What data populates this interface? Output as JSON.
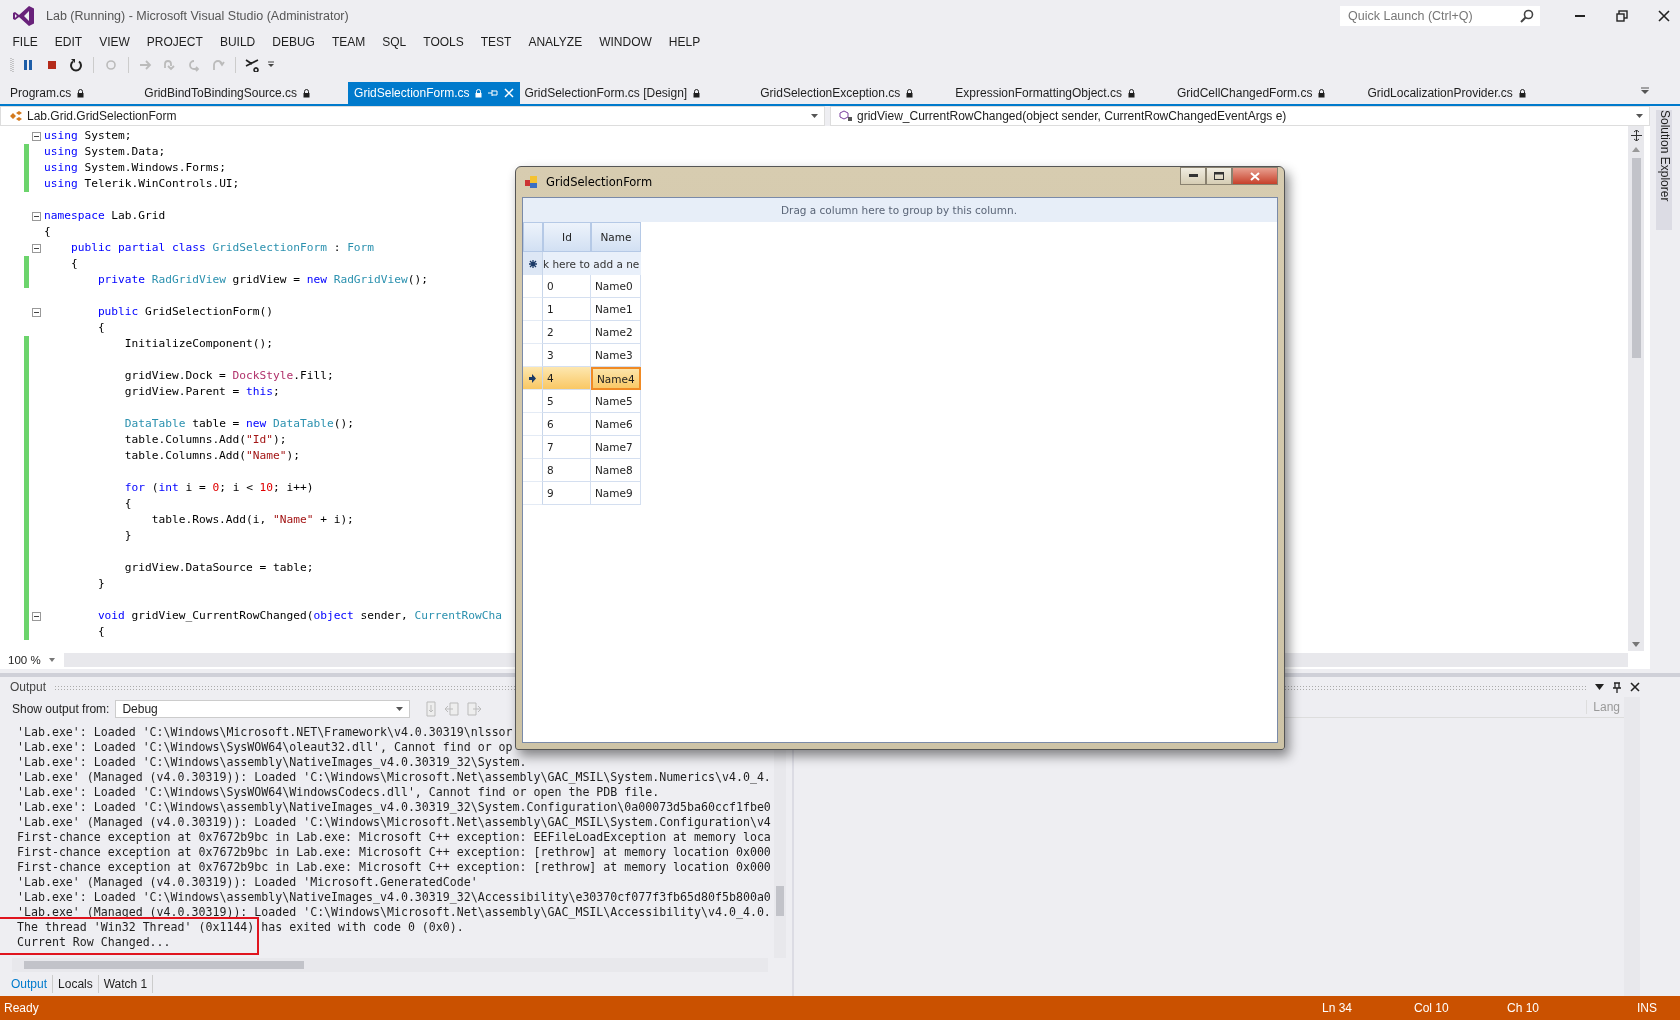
{
  "window": {
    "title": "Lab (Running) - Microsoft Visual Studio (Administrator)",
    "quick_launch": {
      "placeholder": "Quick Launch (Ctrl+Q)"
    }
  },
  "menu": [
    "FILE",
    "EDIT",
    "VIEW",
    "PROJECT",
    "BUILD",
    "DEBUG",
    "TEAM",
    "SQL",
    "TOOLS",
    "TEST",
    "ANALYZE",
    "WINDOW",
    "HELP"
  ],
  "tabs": [
    {
      "label": "Program.cs",
      "selected": false
    },
    {
      "label": "GridBindToBindingSource.cs",
      "selected": false
    },
    {
      "label": "GridSelectionForm.cs",
      "selected": true
    },
    {
      "label": "GridSelectionForm.cs [Design]",
      "selected": false
    },
    {
      "label": "GridSelectionException.cs",
      "selected": false
    },
    {
      "label": "ExpressionFormattingObject.cs",
      "selected": false
    },
    {
      "label": "GridCellChangedForm.cs",
      "selected": false
    },
    {
      "label": "GridLocalizationProvider.cs",
      "selected": false
    }
  ],
  "navigation": {
    "type_box": "Lab.Grid.GridSelectionForm",
    "member_box": "gridView_CurrentRowChanged(object sender, CurrentRowChangedEventArgs e)"
  },
  "code_lines": [
    {
      "kind": "code",
      "changed": false,
      "fold": true,
      "tokens": [
        {
          "kind": "keyword",
          "t": "using"
        },
        {
          "kind": "plain",
          "t": " System;"
        }
      ]
    },
    {
      "kind": "code",
      "changed": true,
      "fold": false,
      "tokens": [
        {
          "kind": "keyword",
          "t": "using"
        },
        {
          "kind": "plain",
          "t": " System.Data;"
        }
      ]
    },
    {
      "kind": "code",
      "changed": true,
      "fold": false,
      "tokens": [
        {
          "kind": "keyword",
          "t": "using"
        },
        {
          "kind": "plain",
          "t": " System.Windows.Forms;"
        }
      ]
    },
    {
      "kind": "code",
      "changed": true,
      "fold": false,
      "tokens": [
        {
          "kind": "keyword",
          "t": "using"
        },
        {
          "kind": "plain",
          "t": " Telerik.WinControls.UI;"
        }
      ]
    },
    {
      "kind": "blank",
      "changed": false,
      "fold": false
    },
    {
      "kind": "code",
      "changed": false,
      "fold": true,
      "tokens": [
        {
          "kind": "keyword",
          "t": "namespace"
        },
        {
          "kind": "plain",
          "t": " Lab.Grid"
        }
      ]
    },
    {
      "kind": "code",
      "changed": false,
      "fold": false,
      "tokens": [
        {
          "kind": "plain",
          "t": "{"
        }
      ]
    },
    {
      "kind": "code",
      "changed": false,
      "fold": true,
      "tokens": [
        {
          "kind": "keyword",
          "t": "    public partial class"
        },
        {
          "kind": "type",
          "t": " GridSelectionForm"
        },
        {
          "kind": "plain",
          "t": " : "
        },
        {
          "kind": "type",
          "t": "Form"
        }
      ]
    },
    {
      "kind": "code",
      "changed": true,
      "fold": false,
      "tokens": [
        {
          "kind": "plain",
          "t": "    {"
        }
      ]
    },
    {
      "kind": "code",
      "changed": true,
      "fold": false,
      "tokens": [
        {
          "kind": "keyword",
          "t": "        private"
        },
        {
          "kind": "type",
          "t": " RadGridView"
        },
        {
          "kind": "plain",
          "t": " gridView = "
        },
        {
          "kind": "keyword",
          "t": "new"
        },
        {
          "kind": "type",
          "t": " RadGridView"
        },
        {
          "kind": "plain",
          "t": "();"
        }
      ]
    },
    {
      "kind": "blank",
      "changed": false,
      "fold": false
    },
    {
      "kind": "code",
      "changed": false,
      "fold": true,
      "tokens": [
        {
          "kind": "keyword",
          "t": "        public"
        },
        {
          "kind": "plain",
          "t": " GridSelectionForm()"
        }
      ]
    },
    {
      "kind": "code",
      "changed": false,
      "fold": false,
      "tokens": [
        {
          "kind": "plain",
          "t": "        {"
        }
      ]
    },
    {
      "kind": "code",
      "changed": true,
      "fold": false,
      "tokens": [
        {
          "kind": "plain",
          "t": "            InitializeComponent();"
        }
      ]
    },
    {
      "kind": "blank",
      "changed": true,
      "fold": false
    },
    {
      "kind": "code",
      "changed": true,
      "fold": false,
      "tokens": [
        {
          "kind": "plain",
          "t": "            gridView.Dock = "
        },
        {
          "kind": "enum",
          "t": "DockStyle"
        },
        {
          "kind": "plain",
          "t": ".Fill;"
        }
      ]
    },
    {
      "kind": "code",
      "changed": true,
      "fold": false,
      "tokens": [
        {
          "kind": "plain",
          "t": "            gridView.Parent = "
        },
        {
          "kind": "keyword",
          "t": "this"
        },
        {
          "kind": "plain",
          "t": ";"
        }
      ]
    },
    {
      "kind": "blank",
      "changed": true,
      "fold": false
    },
    {
      "kind": "code",
      "changed": true,
      "fold": false,
      "tokens": [
        {
          "kind": "type",
          "t": "            DataTable"
        },
        {
          "kind": "plain",
          "t": " table = "
        },
        {
          "kind": "keyword",
          "t": "new"
        },
        {
          "kind": "type",
          "t": " DataTable"
        },
        {
          "kind": "plain",
          "t": "();"
        }
      ]
    },
    {
      "kind": "code",
      "changed": true,
      "fold": false,
      "tokens": [
        {
          "kind": "plain",
          "t": "            table.Columns.Add("
        },
        {
          "kind": "string",
          "t": "\"Id\""
        },
        {
          "kind": "plain",
          "t": ");"
        }
      ]
    },
    {
      "kind": "code",
      "changed": true,
      "fold": false,
      "tokens": [
        {
          "kind": "plain",
          "t": "            table.Columns.Add("
        },
        {
          "kind": "string",
          "t": "\"Name\""
        },
        {
          "kind": "plain",
          "t": ");"
        }
      ]
    },
    {
      "kind": "blank",
      "changed": true,
      "fold": false
    },
    {
      "kind": "code",
      "changed": true,
      "fold": false,
      "tokens": [
        {
          "kind": "keyword",
          "t": "            for"
        },
        {
          "kind": "plain",
          "t": " ("
        },
        {
          "kind": "keyword",
          "t": "int"
        },
        {
          "kind": "plain",
          "t": " i = "
        },
        {
          "kind": "number",
          "t": "0"
        },
        {
          "kind": "plain",
          "t": "; i < "
        },
        {
          "kind": "number",
          "t": "10"
        },
        {
          "kind": "plain",
          "t": "; i++)"
        }
      ]
    },
    {
      "kind": "code",
      "changed": true,
      "fold": false,
      "tokens": [
        {
          "kind": "plain",
          "t": "            {"
        }
      ]
    },
    {
      "kind": "code",
      "changed": true,
      "fold": false,
      "tokens": [
        {
          "kind": "plain",
          "t": "                table.Rows.Add(i, "
        },
        {
          "kind": "string",
          "t": "\"Name\""
        },
        {
          "kind": "plain",
          "t": " + i);"
        }
      ]
    },
    {
      "kind": "code",
      "changed": true,
      "fold": false,
      "tokens": [
        {
          "kind": "plain",
          "t": "            }"
        }
      ]
    },
    {
      "kind": "blank",
      "changed": true,
      "fold": false
    },
    {
      "kind": "code",
      "changed": true,
      "fold": false,
      "tokens": [
        {
          "kind": "plain",
          "t": "            gridView.DataSource = table;"
        }
      ]
    },
    {
      "kind": "code",
      "changed": true,
      "fold": false,
      "tokens": [
        {
          "kind": "plain",
          "t": "        }"
        }
      ]
    },
    {
      "kind": "blank",
      "changed": true,
      "fold": false
    },
    {
      "kind": "code",
      "changed": true,
      "fold": true,
      "tokens": [
        {
          "kind": "keyword",
          "t": "        void"
        },
        {
          "kind": "plain",
          "t": " gridView_CurrentRowChanged("
        },
        {
          "kind": "keyword",
          "t": "object"
        },
        {
          "kind": "plain",
          "t": " sender, "
        },
        {
          "kind": "type",
          "t": "CurrentRowCha"
        }
      ]
    },
    {
      "kind": "code",
      "changed": true,
      "fold": false,
      "tokens": [
        {
          "kind": "plain",
          "t": "        {"
        }
      ]
    }
  ],
  "zoom": "100 %",
  "form": {
    "title": "GridSelectionForm",
    "group_panel": "Drag a column here to group by this column.",
    "columns": [
      "Id",
      "Name"
    ],
    "new_row": "k here to add a ne",
    "rows": [
      {
        "id": "0",
        "name": "Name0",
        "selected": false
      },
      {
        "id": "1",
        "name": "Name1",
        "selected": false
      },
      {
        "id": "2",
        "name": "Name2",
        "selected": false
      },
      {
        "id": "3",
        "name": "Name3",
        "selected": false
      },
      {
        "id": "4",
        "name": "Name4",
        "selected": true
      },
      {
        "id": "5",
        "name": "Name5",
        "selected": false
      },
      {
        "id": "6",
        "name": "Name6",
        "selected": false
      },
      {
        "id": "7",
        "name": "Name7",
        "selected": false
      },
      {
        "id": "8",
        "name": "Name8",
        "selected": false
      },
      {
        "id": "9",
        "name": "Name9",
        "selected": false
      }
    ]
  },
  "output": {
    "title": "Output",
    "show_from_label": "Show output from:",
    "show_from_value": "Debug",
    "side_column": "Lang",
    "lines": [
      "'Lab.exe': Loaded 'C:\\Windows\\Microsoft.NET\\Framework\\v4.0.30319\\nlssor",
      "'Lab.exe': Loaded 'C:\\Windows\\SysWOW64\\oleaut32.dll', Cannot find or op",
      "'Lab.exe': Loaded 'C:\\Windows\\assembly\\NativeImages_v4.0.30319_32\\System.",
      "'Lab.exe' (Managed (v4.0.30319)): Loaded 'C:\\Windows\\Microsoft.Net\\assembly\\GAC_MSIL\\System.Numerics\\v4.0_4.",
      "'Lab.exe': Loaded 'C:\\Windows\\SysWOW64\\WindowsCodecs.dll', Cannot find or open the PDB file.",
      "'Lab.exe': Loaded 'C:\\Windows\\assembly\\NativeImages_v4.0.30319_32\\System.Configuration\\0a00073d5ba60ccf1fbe0",
      "'Lab.exe' (Managed (v4.0.30319)): Loaded 'C:\\Windows\\Microsoft.Net\\assembly\\GAC_MSIL\\System.Configuration\\v4",
      "First-chance exception at 0x7672b9bc in Lab.exe: Microsoft C++ exception: EEFileLoadException at memory loca",
      "First-chance exception at 0x7672b9bc in Lab.exe: Microsoft C++ exception: [rethrow] at memory location 0x000",
      "First-chance exception at 0x7672b9bc in Lab.exe: Microsoft C++ exception: [rethrow] at memory location 0x000",
      "'Lab.exe' (Managed (v4.0.30319)): Loaded 'Microsoft.GeneratedCode'",
      "'Lab.exe': Loaded 'C:\\Windows\\assembly\\NativeImages_v4.0.30319_32\\Accessibility\\e30370cf077f3fb65d80f5b800a0",
      "'Lab.exe' (Managed (v4.0.30319)): Loaded 'C:\\Windows\\Microsoft.Net\\assembly\\GAC_MSIL\\Accessibility\\v4.0_4.0.",
      "The thread 'Win32 Thread' (0x1144) has exited with code 0 (0x0).",
      "Current Row Changed..."
    ],
    "bottom_tabs": [
      {
        "label": "Output",
        "selected": true
      },
      {
        "label": "Locals",
        "selected": false
      },
      {
        "label": "Watch 1",
        "selected": false
      }
    ]
  },
  "side_tab": "Solution Explorer",
  "status_bar": {
    "state": "Ready",
    "line": "Ln 34",
    "column": "Col 10",
    "char": "Ch 10",
    "mode": "INS"
  }
}
